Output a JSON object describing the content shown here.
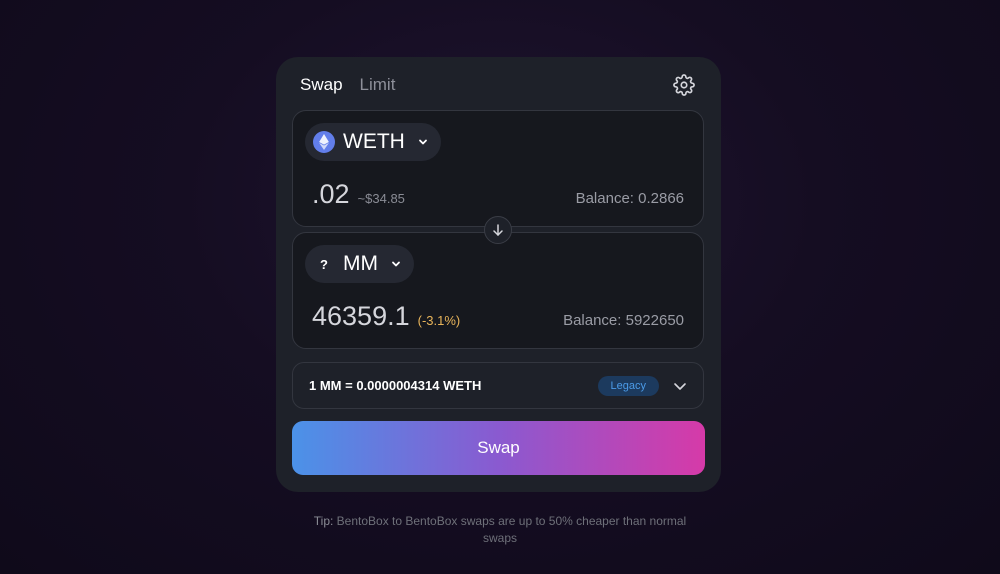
{
  "tabs": [
    {
      "label": "Swap",
      "active": true
    },
    {
      "label": "Limit",
      "active": false
    }
  ],
  "settings_icon": "gear-icon",
  "from": {
    "token": "WETH",
    "icon": "ethereum-icon",
    "amount": ".02",
    "usd": "~$34.85",
    "balance": "Balance: 0.2866"
  },
  "to": {
    "token": "MM",
    "icon_text": "?",
    "amount": "46359.1",
    "impact": "(-3.1%)",
    "balance": "Balance: 5922650"
  },
  "rate": {
    "text": "1 MM = 0.0000004314 WETH",
    "badge": "Legacy"
  },
  "swap_button": "Swap",
  "tip": {
    "label": "Tip:",
    "text": " BentoBox to BentoBox swaps are up to 50% cheaper than normal swaps"
  },
  "colors": {
    "accent_start": "#4b92e8",
    "accent_end": "#d63aa8",
    "impact": "#e8b45a",
    "badge": "#4b9be8"
  }
}
